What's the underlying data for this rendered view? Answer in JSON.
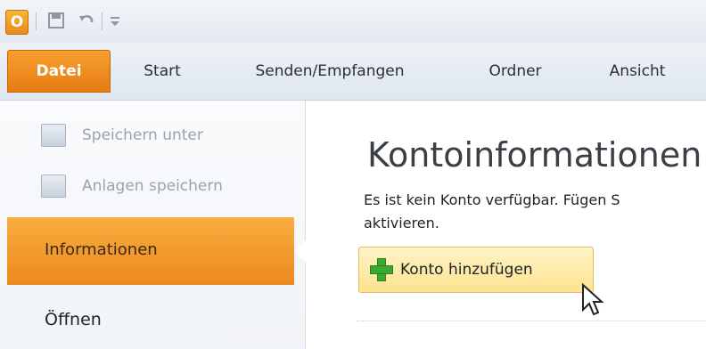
{
  "app": {
    "icon_letter": "O"
  },
  "quick_access": {
    "icons": [
      "save-icon",
      "undo-icon",
      "customize-dropdown-icon"
    ]
  },
  "ribbon": {
    "tabs": [
      {
        "label": "Datei",
        "active": true
      },
      {
        "label": "Start",
        "active": false
      },
      {
        "label": "Senden/Empfangen",
        "active": false
      },
      {
        "label": "Ordner",
        "active": false
      },
      {
        "label": "Ansicht",
        "active": false
      }
    ]
  },
  "backstage": {
    "commands": [
      {
        "label": "Speichern unter",
        "enabled": false,
        "icon": "save-as-icon"
      },
      {
        "label": "Anlagen speichern",
        "enabled": false,
        "icon": "attachments-icon"
      }
    ],
    "nav": [
      {
        "label": "Informationen",
        "selected": true
      },
      {
        "label": "Öffnen",
        "selected": false
      }
    ]
  },
  "content": {
    "heading": "Kontoinformationen",
    "description_line1": "Es ist kein Konto verfügbar. Fügen S",
    "description_line2": "aktivieren.",
    "add_account_label": "Konto hinzufügen"
  },
  "colors": {
    "accent_orange": "#ec8a1f",
    "button_yellow": "#fde38f",
    "plus_green": "#3aa92f"
  }
}
